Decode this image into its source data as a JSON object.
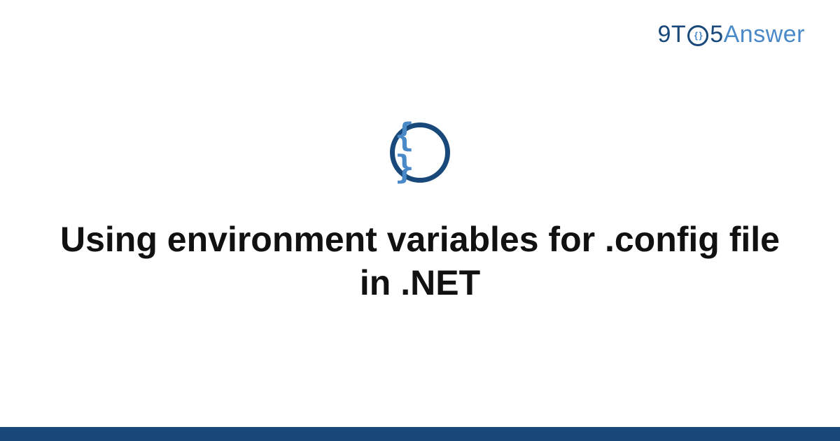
{
  "logo": {
    "prefix": "9T",
    "o_inner": "{ }",
    "five": "5",
    "suffix": "Answer"
  },
  "icon": {
    "glyph": "{ }",
    "semantic": "code-braces-icon"
  },
  "headline": "Using environment variables for .config file in .NET",
  "colors": {
    "dark_blue": "#18497a",
    "light_blue": "#4a89c8",
    "text": "#111111",
    "background": "#ffffff"
  }
}
